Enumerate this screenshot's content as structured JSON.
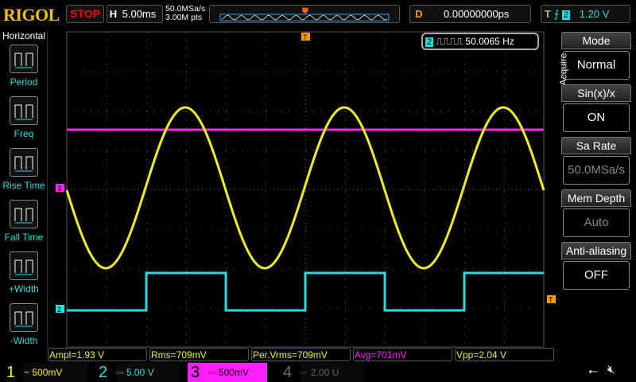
{
  "header": {
    "logo": "RIGOL",
    "run_state": "STOP",
    "h_label": "H",
    "timebase": "5.00ms",
    "sample_rate": "50.0MSa/s",
    "mem_points": "3.00M pts",
    "d_label": "D",
    "delay": "0.00000000ps",
    "t_label": "T",
    "trigger_source": "2",
    "trigger_level": "1.20 V"
  },
  "left_menu": {
    "title": "Horizontal",
    "items": [
      {
        "label": "Period",
        "icon": "period-icon"
      },
      {
        "label": "Freq",
        "icon": "freq-icon"
      },
      {
        "label": "Rise Time",
        "icon": "rise-time-icon"
      },
      {
        "label": "Fall Time",
        "icon": "fall-time-icon"
      },
      {
        "label": "+Width",
        "icon": "positive-width-icon"
      },
      {
        "label": "-Width",
        "icon": "negative-width-icon"
      }
    ]
  },
  "freq_counter": {
    "channel": "2",
    "value": "50.0065 Hz"
  },
  "right_menu": {
    "title": "Acquire",
    "items": [
      {
        "label": "Mode",
        "value": "Normal"
      },
      {
        "label": "Sin(x)/x",
        "value": "ON"
      },
      {
        "label": "Sa Rate",
        "value": "50.0MSa/s"
      },
      {
        "label": "Mem Depth",
        "value": "Auto"
      },
      {
        "label": "Anti-aliasing",
        "value": "OFF"
      }
    ]
  },
  "measurements": [
    {
      "text": "Ampl=1.93 V",
      "color": "#f0f020"
    },
    {
      "text": "Rms=709mV",
      "color": "#f0f020"
    },
    {
      "text": "Per.Vrms=709mV",
      "color": "#f0f020"
    },
    {
      "text": "Avg=701mV",
      "color": "#ff20ff"
    },
    {
      "text": "Vpp=2.04 V",
      "color": "#f0f020"
    }
  ],
  "channels": [
    {
      "num": "1",
      "coupling": "~",
      "scale": "500mV",
      "color": "#f0f020"
    },
    {
      "num": "2",
      "coupling": "⎓",
      "scale": "5.00 V",
      "color": "#20e0e0"
    },
    {
      "num": "3",
      "coupling": "⎓",
      "scale": "500mV",
      "color": "#ff20ff"
    },
    {
      "num": "4",
      "coupling": "⎓",
      "scale": "2.00 U",
      "color": "#666666"
    }
  ],
  "markers": {
    "ch3": "3",
    "ch2": "2",
    "trigger": "T"
  }
}
